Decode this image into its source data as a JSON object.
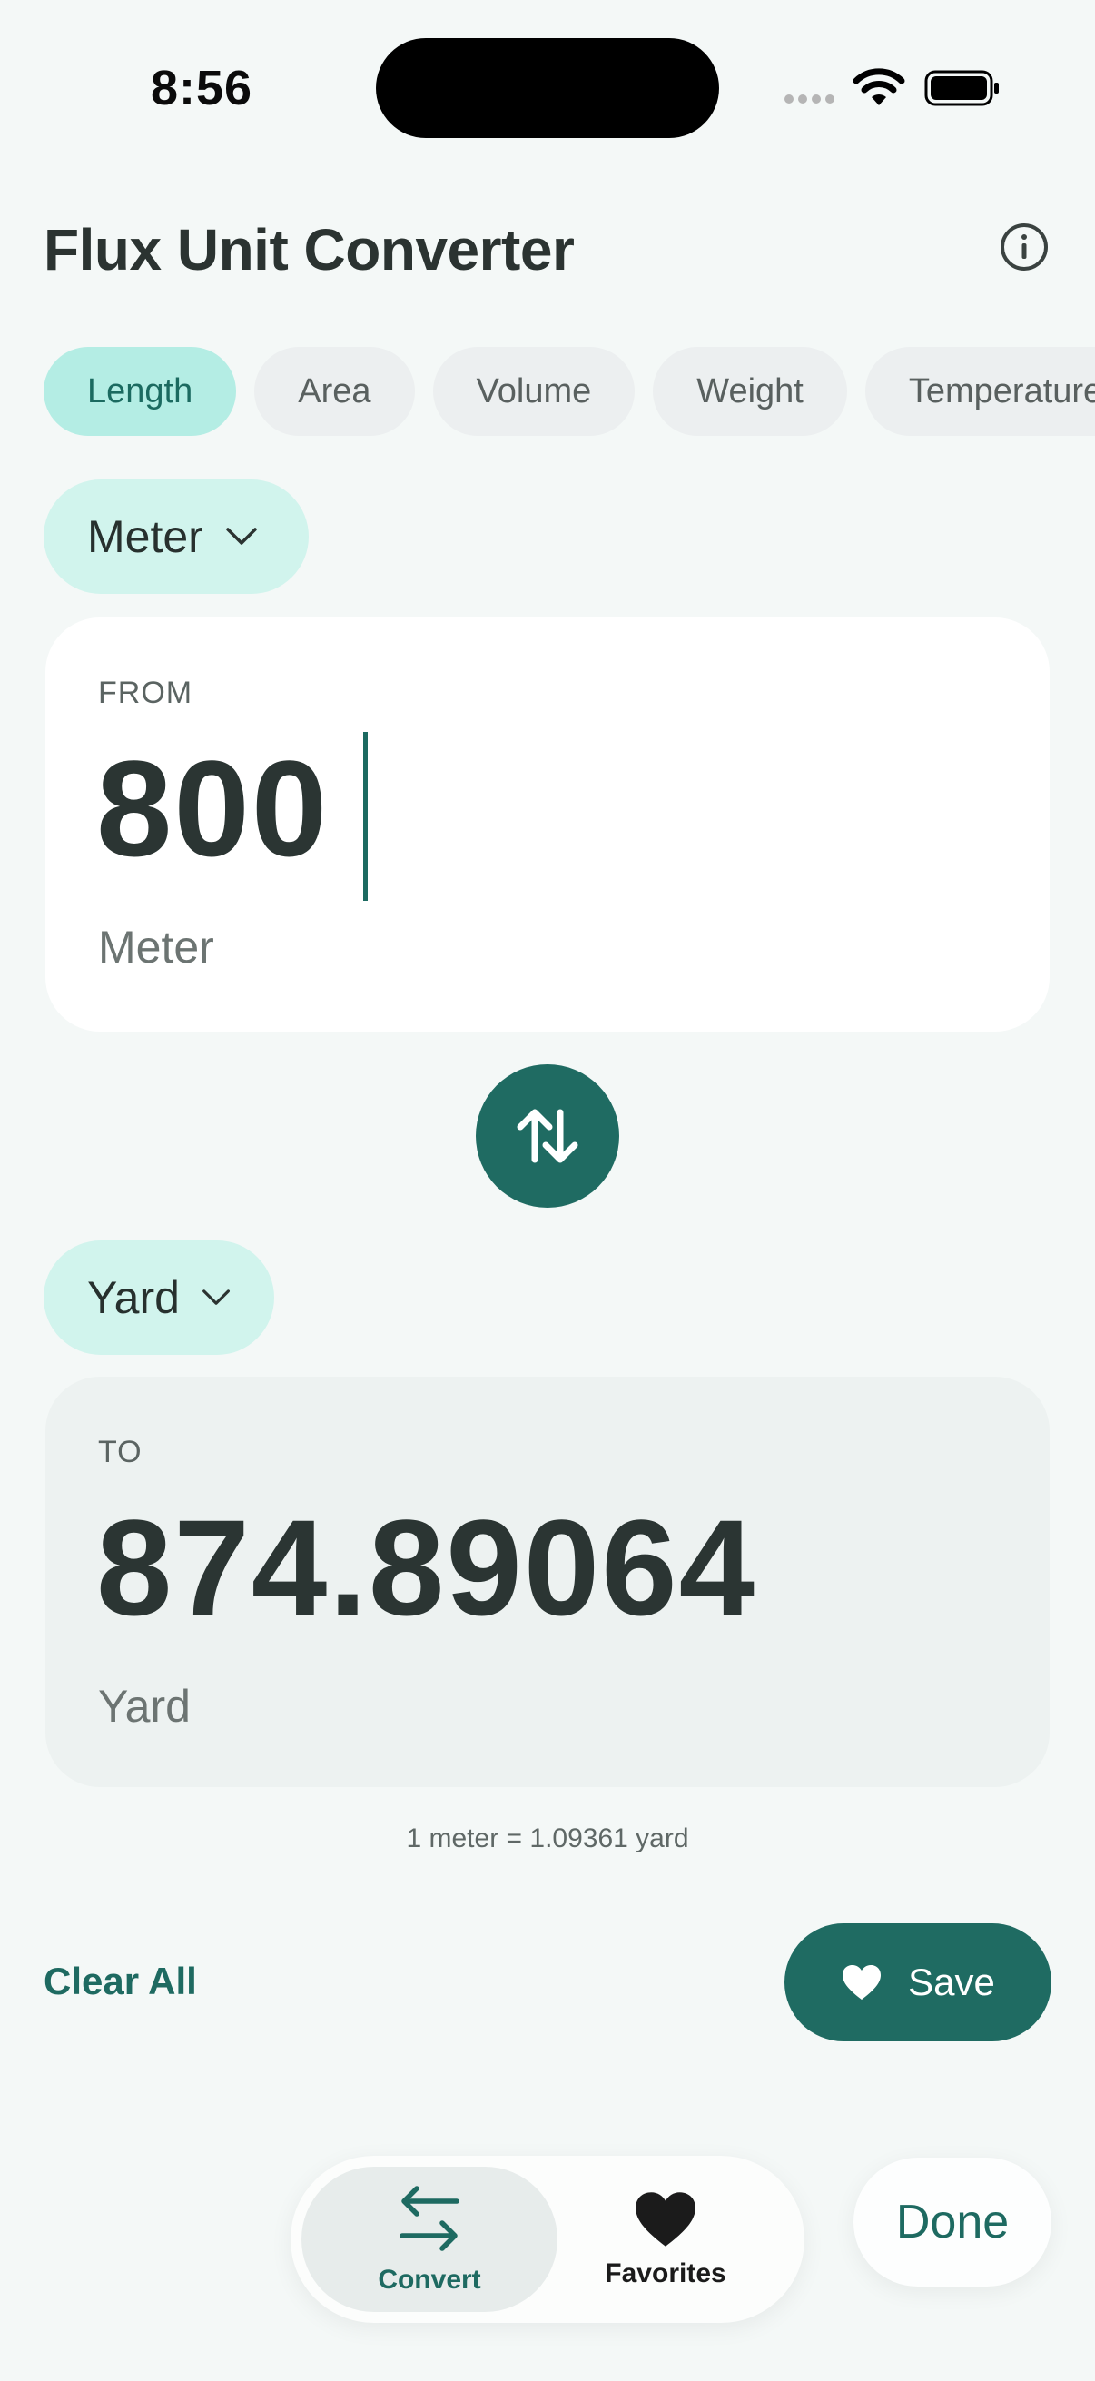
{
  "status_bar": {
    "time": "8:56"
  },
  "header": {
    "title": "Flux Unit Converter"
  },
  "categories": [
    {
      "label": "Length",
      "active": true
    },
    {
      "label": "Area",
      "active": false
    },
    {
      "label": "Volume",
      "active": false
    },
    {
      "label": "Weight",
      "active": false
    },
    {
      "label": "Temperature",
      "active": false
    }
  ],
  "from": {
    "unit_select": "Meter",
    "label": "FROM",
    "value": "800",
    "unit": "Meter"
  },
  "to": {
    "unit_select": "Yard",
    "label": "TO",
    "value": "874.89064",
    "unit": "Yard"
  },
  "rate": "1 meter = 1.09361 yard",
  "actions": {
    "clear": "Clear All",
    "save": "Save"
  },
  "tabbar": {
    "convert": "Convert",
    "favorites": "Favorites"
  },
  "done": "Done",
  "colors": {
    "accent": "#1f6b62",
    "chip_active": "#b4ede4",
    "unit_select_bg": "#d1f4ed",
    "background": "#f4f8f7"
  }
}
